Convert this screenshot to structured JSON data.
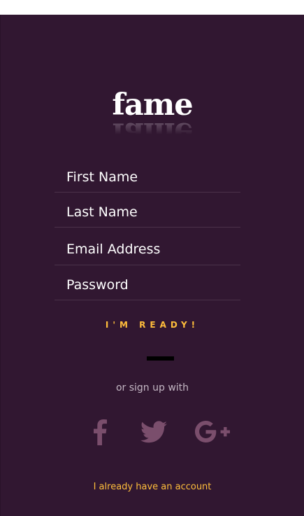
{
  "app": {
    "logo_text": "fame"
  },
  "form": {
    "first_name": {
      "placeholder": "First Name",
      "value": ""
    },
    "last_name": {
      "placeholder": "Last Name",
      "value": ""
    },
    "email": {
      "placeholder": "Email Address",
      "value": ""
    },
    "password": {
      "placeholder": "Password",
      "value": ""
    }
  },
  "actions": {
    "submit_label": "I'M READY!",
    "or_text": "or sign up with",
    "login_link": "I already have an account"
  },
  "social": [
    {
      "name": "facebook",
      "icon": "facebook-icon"
    },
    {
      "name": "twitter",
      "icon": "twitter-icon"
    },
    {
      "name": "google-plus",
      "icon": "google-plus-icon"
    }
  ],
  "colors": {
    "background": "#311731",
    "accent": "#ffbe3b",
    "social_icon": "#7a4e6c",
    "field_divider": "#4b3249"
  }
}
